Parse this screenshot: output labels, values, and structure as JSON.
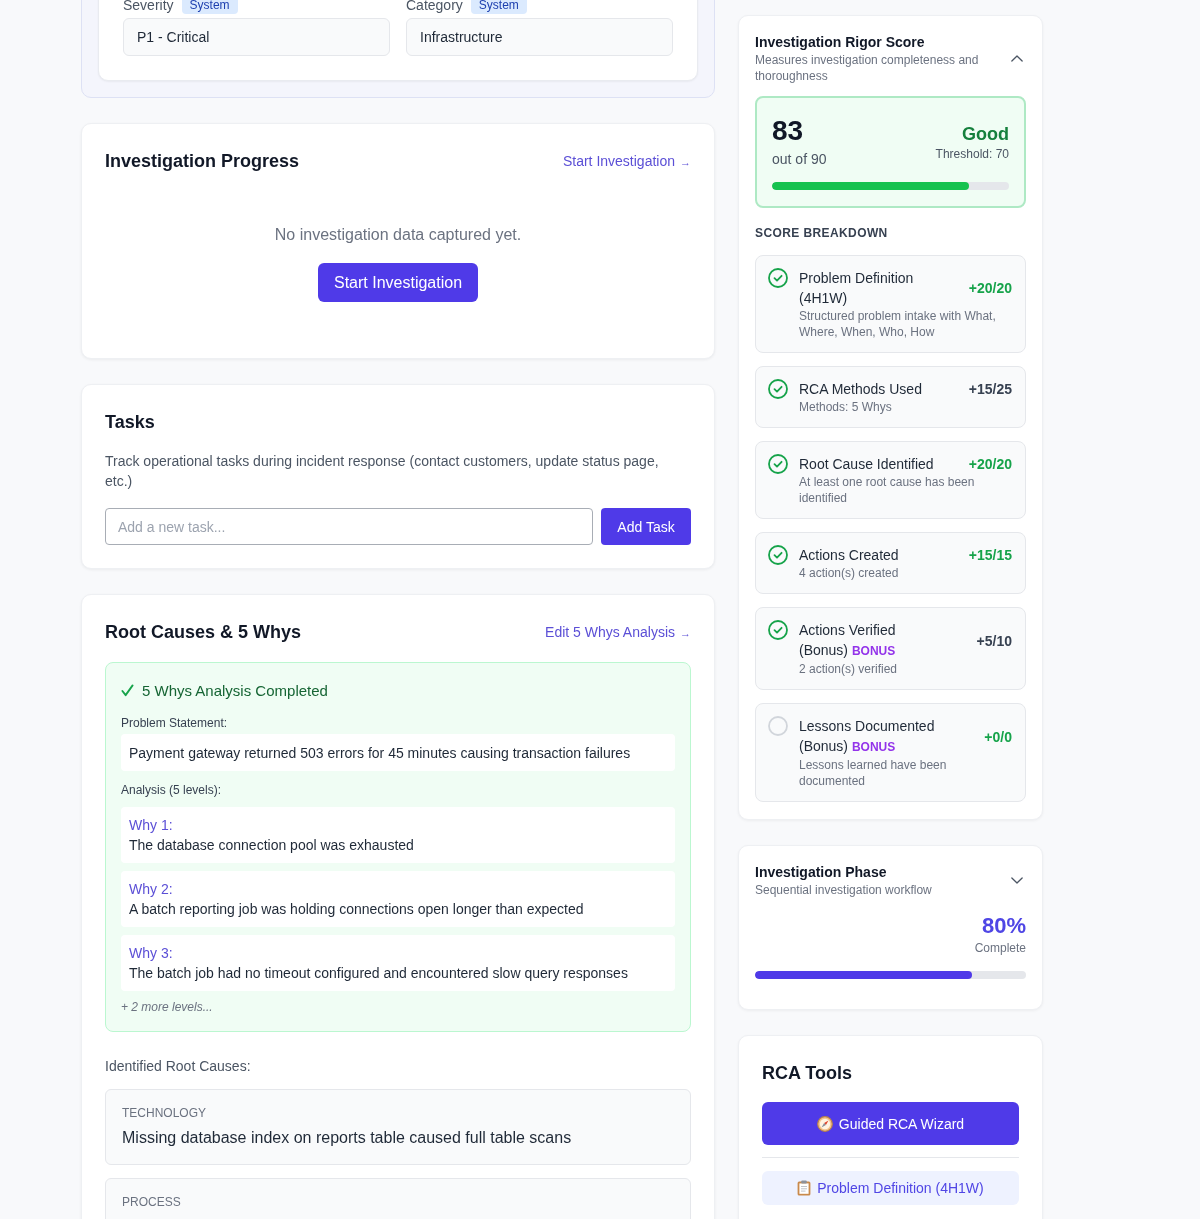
{
  "incident_fields": {
    "fields": [
      {
        "label": "Severity",
        "badge": "System",
        "value": "P1 - Critical"
      },
      {
        "label": "Category",
        "badge": "System",
        "value": "Infrastructure"
      }
    ]
  },
  "investigation_progress": {
    "title": "Investigation Progress",
    "link": {
      "label": "Start Investigation",
      "arrow": "→"
    },
    "empty_text": "No investigation data captured yet.",
    "button": "Start Investigation"
  },
  "tasks": {
    "title": "Tasks",
    "description": "Track operational tasks during incident response (contact customers, update status page, etc.)",
    "input": {
      "placeholder": "Add a new task..."
    },
    "button": "Add Task"
  },
  "root_causes": {
    "title": "Root Causes & 5 Whys",
    "link": {
      "label": "Edit 5 Whys Analysis",
      "arrow": "→"
    },
    "five_whys": {
      "status": "5 Whys Analysis Completed",
      "problem_label": "Problem Statement:",
      "problem": "Payment gateway returned 503 errors for 45 minutes causing transaction failures",
      "analysis_label": "Analysis (5 levels):",
      "whys": [
        {
          "label": "Why 1:",
          "text": "The database connection pool was exhausted"
        },
        {
          "label": "Why 2:",
          "text": "A batch reporting job was holding connections open longer than expected"
        },
        {
          "label": "Why 3:",
          "text": "The batch job had no timeout configured and encountered slow query responses"
        }
      ],
      "more": "+ 2 more levels..."
    },
    "identified_label": "Identified Root Causes:",
    "items": [
      {
        "category": "TECHNOLOGY",
        "text": "Missing database index on reports table caused full table scans"
      },
      {
        "category": "PROCESS"
      }
    ]
  },
  "rigor_score": {
    "title": "Investigation Rigor Score",
    "subtitle": "Measures investigation completeness and thoroughness",
    "expanded": true,
    "score": "83",
    "out_of": "out of 90",
    "rating": "Good",
    "threshold": "Threshold: 70",
    "level": 0.83,
    "breakdown_title": "SCORE BREAKDOWN",
    "breakdown": [
      {
        "name": "Problem Definition (4H1W)",
        "points": "+20/20",
        "full_score": true,
        "done": true,
        "description": "Structured problem intake with What, Where, When, Who, How"
      },
      {
        "name": "RCA Methods Used",
        "points": "+15/25",
        "full_score": false,
        "done": true,
        "description": "Methods: 5 Whys"
      },
      {
        "name": "Root Cause Identified",
        "points": "+20/20",
        "full_score": true,
        "done": true,
        "description": "At least one root cause has been identified"
      },
      {
        "name": "Actions Created",
        "points": "+15/15",
        "full_score": true,
        "done": true,
        "description": "4 action(s) created"
      },
      {
        "name": "Actions Verified (Bonus)",
        "badge": "BONUS",
        "points": "+5/10",
        "full_score": false,
        "done": true,
        "description": "2 action(s) verified"
      },
      {
        "name": "Lessons Documented (Bonus)",
        "badge": "BONUS",
        "points": "+0/0",
        "full_score": true,
        "done": false,
        "description": "Lessons learned have been documented"
      }
    ]
  },
  "investigation_phase": {
    "title": "Investigation Phase",
    "subtitle": "Sequential investigation workflow",
    "expanded": false,
    "percent": "80%",
    "percent_label": "Complete",
    "level": 0.8
  },
  "rca_tools": {
    "title": "RCA Tools",
    "buttons": [
      {
        "label": "Guided RCA Wizard",
        "kind": "primary"
      },
      {
        "label": "Problem Definition (4H1W)",
        "kind": "secondary"
      }
    ]
  }
}
